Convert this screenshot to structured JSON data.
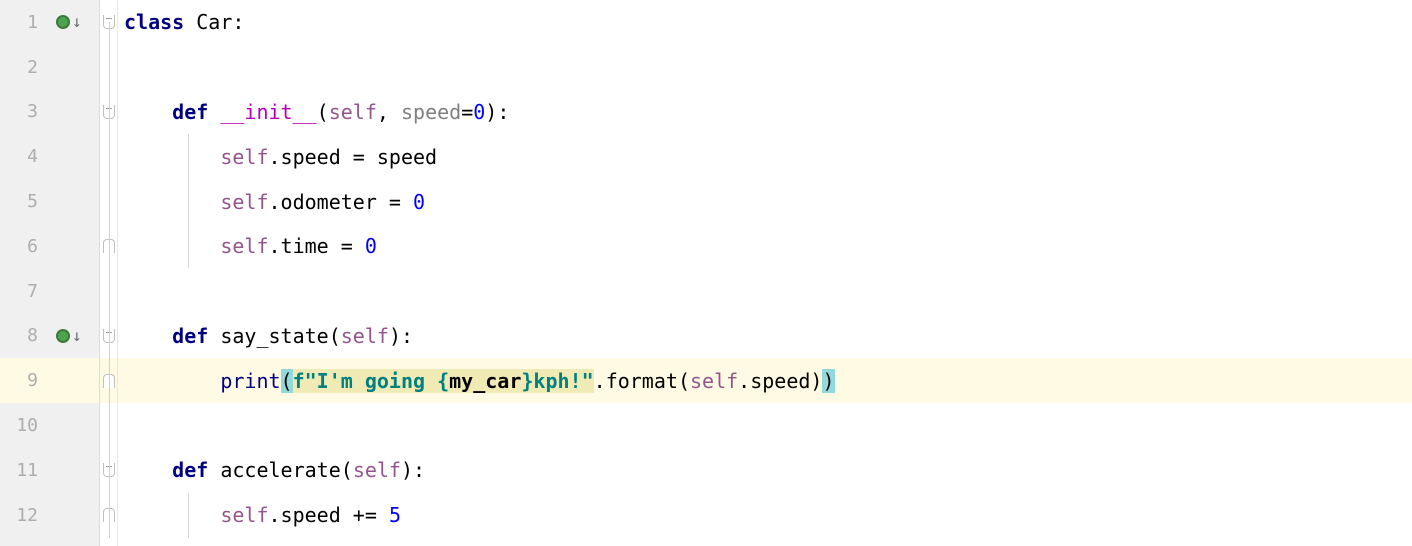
{
  "lines": {
    "l1": "1",
    "l2": "2",
    "l3": "3",
    "l4": "4",
    "l5": "5",
    "l6": "6",
    "l7": "7",
    "l8": "8",
    "l9": "9",
    "l10": "10",
    "l11": "11",
    "l12": "12"
  },
  "code": {
    "class_kw": "class ",
    "class_name": "Car",
    "colon": ":",
    "def_kw": "def ",
    "init_name": "__init__",
    "lp": "(",
    "rp": ")",
    "self": "self",
    "comma_sp": ", ",
    "speed_param": "speed",
    "eq": "=",
    "zero": "0",
    "dot": ".",
    "speed_attr": "speed",
    "assign": " = ",
    "odometer_attr": "odometer",
    "time_attr": "time",
    "say_state": "say_state",
    "print": "print",
    "fprefix": "f",
    "str_open": "\"I'm going {",
    "mycar": "my_car",
    "str_close": "}kph!\"",
    "format": "format",
    "accelerate": "accelerate",
    "pluseq": " += ",
    "five": "5",
    "indent1": "    ",
    "indent2": "        "
  }
}
